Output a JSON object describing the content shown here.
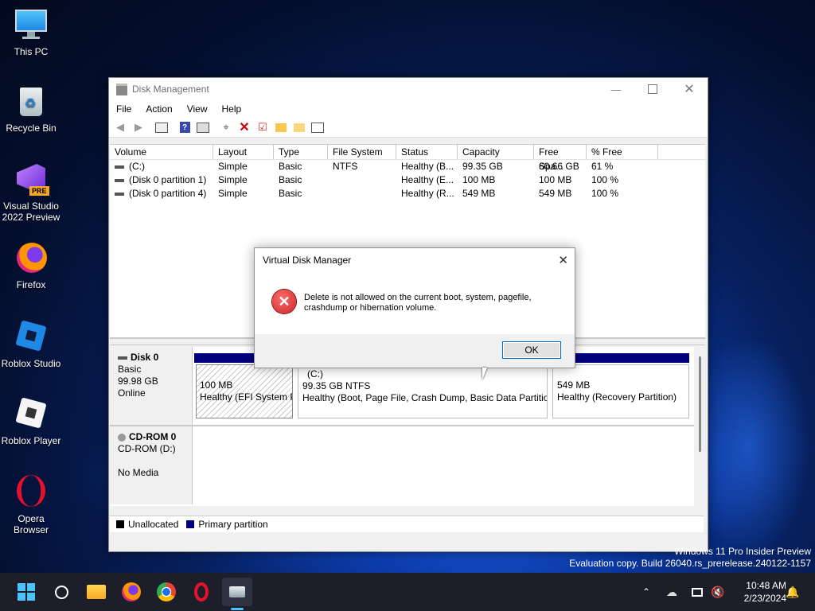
{
  "desktop": {
    "icons": [
      {
        "label": "This PC",
        "icon": "monitor-icon"
      },
      {
        "label": "Recycle Bin",
        "icon": "recycle-bin-icon"
      },
      {
        "label": "Visual Studio 2022 Preview",
        "icon": "visual-studio-icon",
        "badge": "PRE"
      },
      {
        "label": "Firefox",
        "icon": "firefox-icon"
      },
      {
        "label": "Roblox Studio",
        "icon": "roblox-studio-icon"
      },
      {
        "label": "Roblox Player",
        "icon": "roblox-player-icon"
      },
      {
        "label": "Opera Browser",
        "icon": "opera-icon"
      }
    ],
    "watermark": {
      "line1": "Windows 11 Pro Insider Preview",
      "line2": "Evaluation copy. Build 26040.rs_prerelease.240122-1157"
    }
  },
  "window": {
    "title": "Disk Management",
    "menu": [
      "File",
      "Action",
      "View",
      "Help"
    ],
    "toolbar": [
      "back-icon",
      "forward-icon",
      "properties-pane-icon",
      "help-icon",
      "console-icon",
      "connect-disk-icon",
      "delete-icon",
      "checkmark-icon",
      "folder-up-icon",
      "search-folder-icon",
      "list-view-icon"
    ],
    "columns": [
      "Volume",
      "Layout",
      "Type",
      "File System",
      "Status",
      "Capacity",
      "Free Spa...",
      "% Free"
    ],
    "volumes": [
      {
        "volume": "(C:)",
        "layout": "Simple",
        "type": "Basic",
        "fs": "NTFS",
        "status": "Healthy (B...",
        "capacity": "99.35 GB",
        "free": "60.66 GB",
        "pct": "61 %"
      },
      {
        "volume": "(Disk 0 partition 1)",
        "layout": "Simple",
        "type": "Basic",
        "fs": "",
        "status": "Healthy (E...",
        "capacity": "100 MB",
        "free": "100 MB",
        "pct": "100 %"
      },
      {
        "volume": "(Disk 0 partition 4)",
        "layout": "Simple",
        "type": "Basic",
        "fs": "",
        "status": "Healthy (R...",
        "capacity": "549 MB",
        "free": "549 MB",
        "pct": "100 %"
      }
    ],
    "disks": [
      {
        "name": "Disk 0",
        "type": "Basic",
        "size": "99.98 GB",
        "state": "Online",
        "partitions": [
          {
            "title": "",
            "size": "100 MB",
            "desc": "Healthy (EFI System P"
          },
          {
            "title": "(C:)",
            "size": "99.35 GB NTFS",
            "desc": "Healthy (Boot, Page File, Crash Dump, Basic Data Partition"
          },
          {
            "title": "",
            "size": "549 MB",
            "desc": "Healthy (Recovery Partition)"
          }
        ]
      },
      {
        "name": "CD-ROM 0",
        "type": "CD-ROM (D:)",
        "state": "No Media"
      }
    ],
    "legend": [
      {
        "label": "Unallocated",
        "color": "#000000"
      },
      {
        "label": "Primary partition",
        "color": "#00007f"
      }
    ]
  },
  "dialog": {
    "title": "Virtual Disk Manager",
    "message_line1": "Delete is not allowed on the current boot, system, pagefile,",
    "message_line2": "crashdump or hibernation volume.",
    "ok": "OK"
  },
  "taskbar": {
    "apps": [
      "start-icon",
      "search-icon",
      "file-explorer-icon",
      "firefox-icon",
      "chrome-icon",
      "opera-icon",
      "disk-management-icon"
    ],
    "time": "10:48 AM",
    "date": "2/23/2024"
  }
}
